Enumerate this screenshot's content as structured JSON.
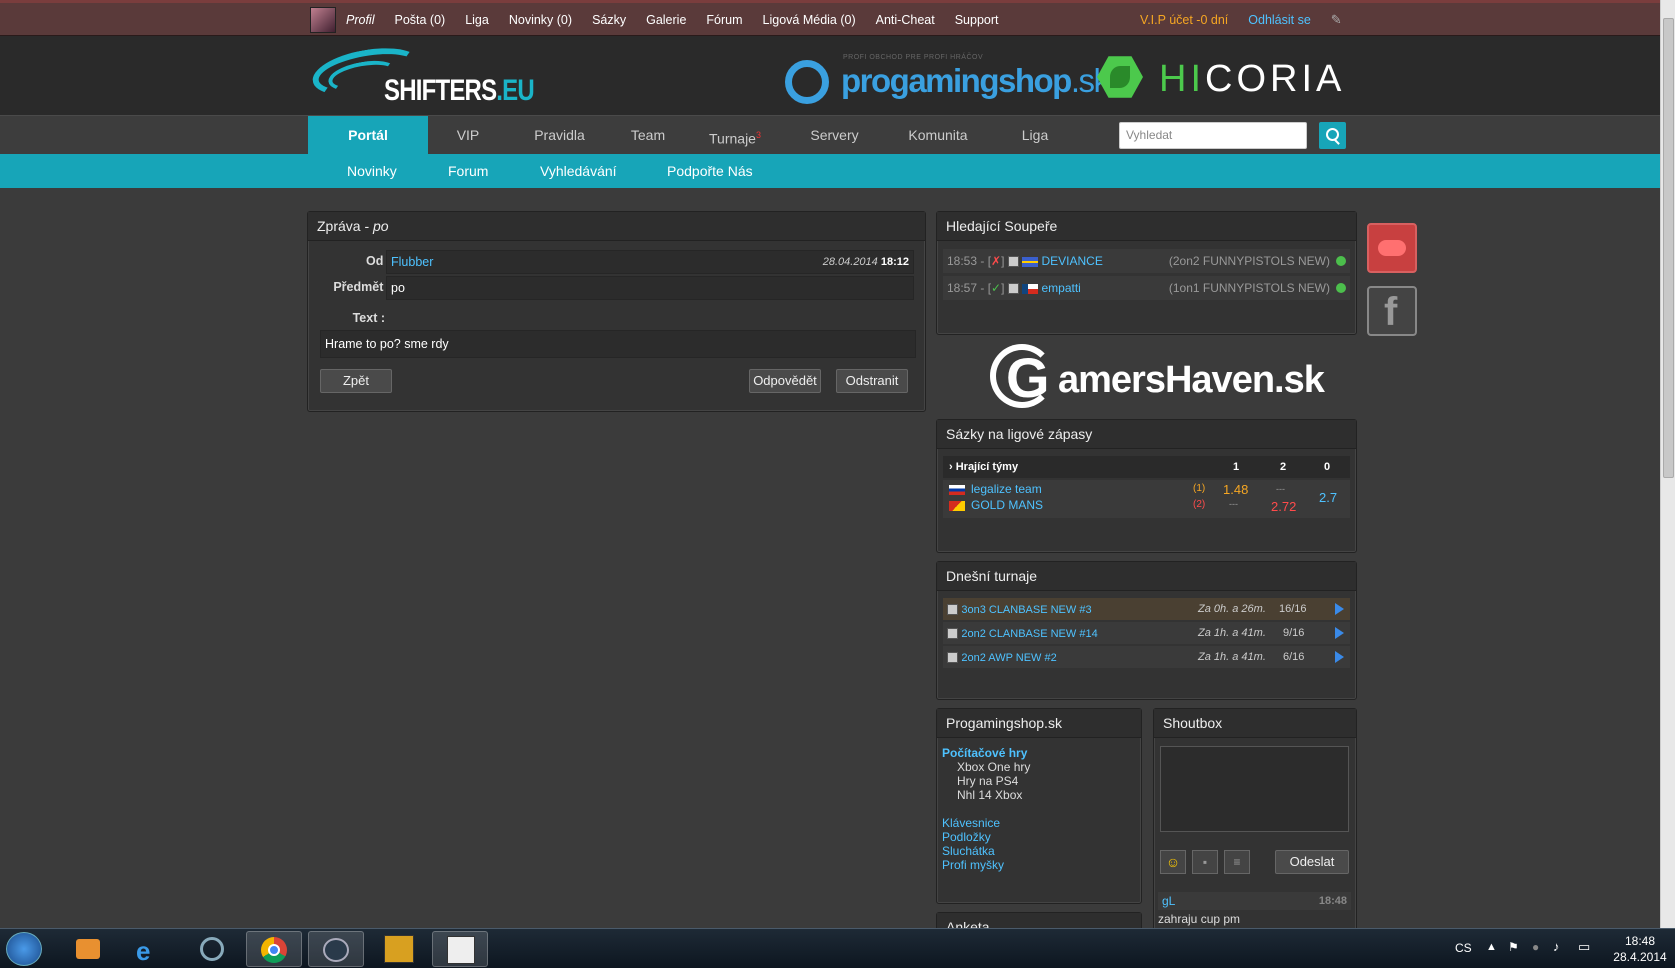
{
  "topbar": {
    "items": [
      "Profil",
      "Pošta (0)",
      "Liga",
      "Novinky (0)",
      "Sázky",
      "Galerie",
      "Fórum",
      "Ligová Média (0)",
      "Anti-Cheat",
      "Support"
    ],
    "vip": "V.I.P účet -0 dní",
    "logout": "Odhlásit se"
  },
  "header": {
    "logo_main": "SHIFTERS",
    "logo_suffix": ".EU",
    "pgs_tag": "PROFI OBCHOD PRE PROFI HRÁČOV",
    "pgs_name": "progamingshop",
    "pgs_suffix": ".sk",
    "hicoria_a": "HI",
    "hicoria_b": "CORIA"
  },
  "mainnav": {
    "items": [
      "Portál",
      "VIP",
      "Pravidla",
      "Team",
      "Turnaje",
      "Servery",
      "Komunita",
      "Liga"
    ],
    "turnaje_badge": "3",
    "search_placeholder": "Vyhledat"
  },
  "subnav": {
    "items": [
      "Novinky",
      "Forum",
      "Vyhledávání",
      "Podpořte Nás"
    ]
  },
  "message": {
    "title": "Zpráva - ",
    "title_subject": "po",
    "from_label": "Od :",
    "from_value": "Flubber",
    "date": "28.04.2014",
    "time": "18:12",
    "subject_label": "Předmět :",
    "subject_value": "po",
    "text_label": "Text :",
    "text_value": "Hrame to po? sme rdy",
    "back": "Zpět",
    "reply": "Odpovědět",
    "delete": "Odstranit"
  },
  "opponents": {
    "title": "Hledající Soupeře",
    "rows": [
      {
        "time": "18:53 - [",
        "mark": "✗",
        "close": "]",
        "team": "DEVIANCE",
        "mode": "(2on2 FUNNYPISTOLS NEW)"
      },
      {
        "time": "18:57 - [",
        "mark": "✓",
        "close": "]",
        "team": "empatti",
        "mode": "(1on1 FUNNYPISTOLS NEW)"
      }
    ]
  },
  "banner": {
    "text": "amersHaven.sk",
    "g": "G"
  },
  "bets": {
    "title": "Sázky na ligové zápasy",
    "head": [
      "› Hrající týmy",
      "1",
      "2",
      "0"
    ],
    "team1": "legalize team",
    "team1_n": "(1)",
    "team2": "GOLD MANS",
    "team2_n": "(2)",
    "odd1": "1.48",
    "odd1b": "---",
    "odd2a": "---",
    "odd2": "2.72",
    "odd0": "2.7"
  },
  "tournaments": {
    "title": "Dnešní turnaje",
    "rows": [
      {
        "name": "3on3 CLANBASE NEW #3",
        "when": "Za 0h. a 26m.",
        "slots": "16/16"
      },
      {
        "name": "2on2 CLANBASE NEW #14",
        "when": "Za 1h. a 41m.",
        "slots": "9/16"
      },
      {
        "name": "2on2 AWP NEW #2",
        "when": "Za 1h. a 41m.",
        "slots": "6/16"
      }
    ]
  },
  "shop": {
    "title": "Progamingshop.sk",
    "category": "Počítačové hry",
    "sub": [
      "Xbox One hry",
      "Hry na PS4",
      "Nhl 14 Xbox"
    ],
    "links": [
      "Klávesnice",
      "Podložky",
      "Sluchátka",
      "Profi myšky"
    ]
  },
  "shoutbox": {
    "title": "Shoutbox",
    "send": "Odeslat",
    "post_user": "gL",
    "post_time": "18:48",
    "post_text": "zahraju cup pm"
  },
  "poll": {
    "title": "Anketa"
  },
  "taskbar": {
    "lang": "CS",
    "time": "18:48",
    "date": "28.4.2014"
  }
}
